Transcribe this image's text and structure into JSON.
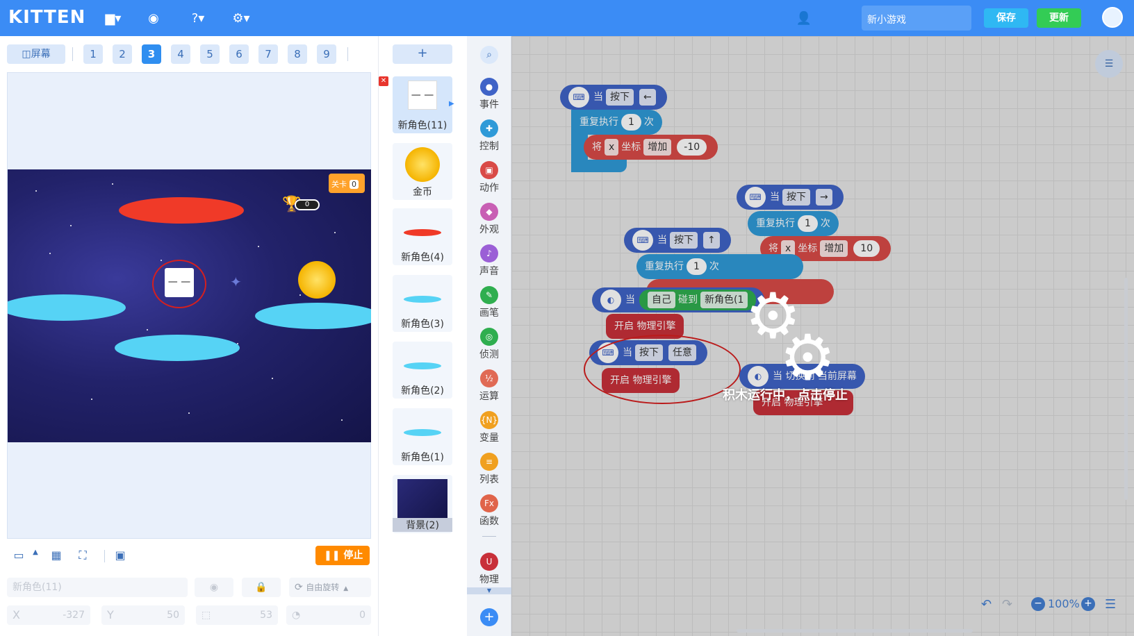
{
  "app": {
    "logo": "KITTEN",
    "game_name": "新小游戏",
    "save_label": "保存",
    "update_label": "更新"
  },
  "toolbar_icons": [
    "folder-icon",
    "backpack-icon",
    "help-icon",
    "settings-icon",
    "add-user-icon"
  ],
  "stage_panel": {
    "screen_label": "屏幕",
    "pages": [
      "1",
      "2",
      "3",
      "4",
      "5",
      "6",
      "7",
      "8",
      "9"
    ],
    "active_page": "3",
    "level_label": "关卡",
    "level_value": "0",
    "trophy_count": "0",
    "stop_label": "停止",
    "sprite_name_field": "新角色(11)",
    "rotation_label": "自由旋转",
    "x_label": "X",
    "x_value": "-327",
    "y_label": "Y",
    "y_value": "50",
    "size_value": "53",
    "direction_value": "0"
  },
  "sprites": {
    "add_label": "+",
    "items": [
      {
        "label": "新角色(11)"
      },
      {
        "label": "金币"
      },
      {
        "label": "新角色(4)"
      },
      {
        "label": "新角色(3)"
      },
      {
        "label": "新角色(2)"
      },
      {
        "label": "新角色(1)"
      },
      {
        "label": "背景(2)"
      }
    ]
  },
  "categories": [
    {
      "label": "事件",
      "color": "#3f63c7"
    },
    {
      "label": "控制",
      "color": "#2f9ad8"
    },
    {
      "label": "动作",
      "color": "#d94a47"
    },
    {
      "label": "外观",
      "color": "#c85fb4"
    },
    {
      "label": "声音",
      "color": "#9b5fd6"
    },
    {
      "label": "画笔",
      "color": "#2fae4f"
    },
    {
      "label": "侦测",
      "color": "#2fae4f"
    },
    {
      "label": "运算",
      "color": "#e06a55"
    },
    {
      "label": "变量",
      "color": "#f0a020"
    },
    {
      "label": "列表",
      "color": "#f0a020"
    },
    {
      "label": "函数",
      "color": "#e0644a"
    },
    {
      "label": "物理",
      "color": "#c8303a"
    }
  ],
  "blocks": {
    "when": "当",
    "key_pressed": "按下",
    "left_arrow": "←",
    "repeat": "重复执行",
    "times": "次",
    "set": "将",
    "x_var": "x",
    "coord": "坐标",
    "increase": "增加",
    "one": "1",
    "neg_ten": "-10",
    "right_arrow": "→",
    "ten": "10",
    "up_arrow": "↑",
    "self": "自己",
    "touch": "碰到",
    "touch_target": "新角色(1",
    "physics_on": "开启 物理引擎",
    "any": "任意",
    "switch_screen": "当 切换到 当前屏幕",
    "running_msg": "积木运行中，点击停止"
  },
  "zoom": "100%"
}
